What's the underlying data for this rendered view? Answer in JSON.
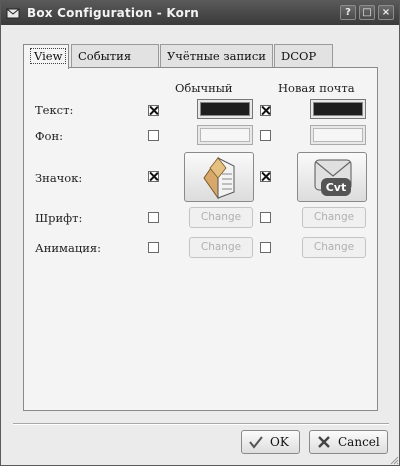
{
  "window": {
    "title": "Box Configuration - Korn",
    "help": "?",
    "maximize": "□",
    "close": "×"
  },
  "tabs": [
    {
      "label": "View",
      "active": true
    },
    {
      "label": "События",
      "active": false
    },
    {
      "label": "Учётные записи",
      "active": false
    },
    {
      "label": "DCOP",
      "active": false
    }
  ],
  "columns": {
    "normal": "Обычный",
    "new_mail": "Новая почта"
  },
  "rows": {
    "text": {
      "label": "Текст:",
      "normal_checked": true,
      "new_checked": true,
      "normal_color": "#1e1e1e",
      "new_color": "#1e1e1e"
    },
    "background": {
      "label": "Фон:",
      "normal_checked": false,
      "new_checked": false
    },
    "icon": {
      "label": "Значок:",
      "normal_checked": true,
      "new_checked": true,
      "normal_icon": "mail-arrow-icon",
      "new_icon": "mail-cvt-icon",
      "new_icon_text": "Cvt"
    },
    "font": {
      "label": "Шрифт:",
      "normal_checked": false,
      "new_checked": false,
      "normal_button": "Change",
      "new_button": "Change"
    },
    "animation": {
      "label": "Анимация:",
      "normal_checked": false,
      "new_checked": false,
      "normal_button": "Change",
      "new_button": "Change"
    }
  },
  "buttons": {
    "ok": "OK",
    "cancel": "Cancel"
  }
}
